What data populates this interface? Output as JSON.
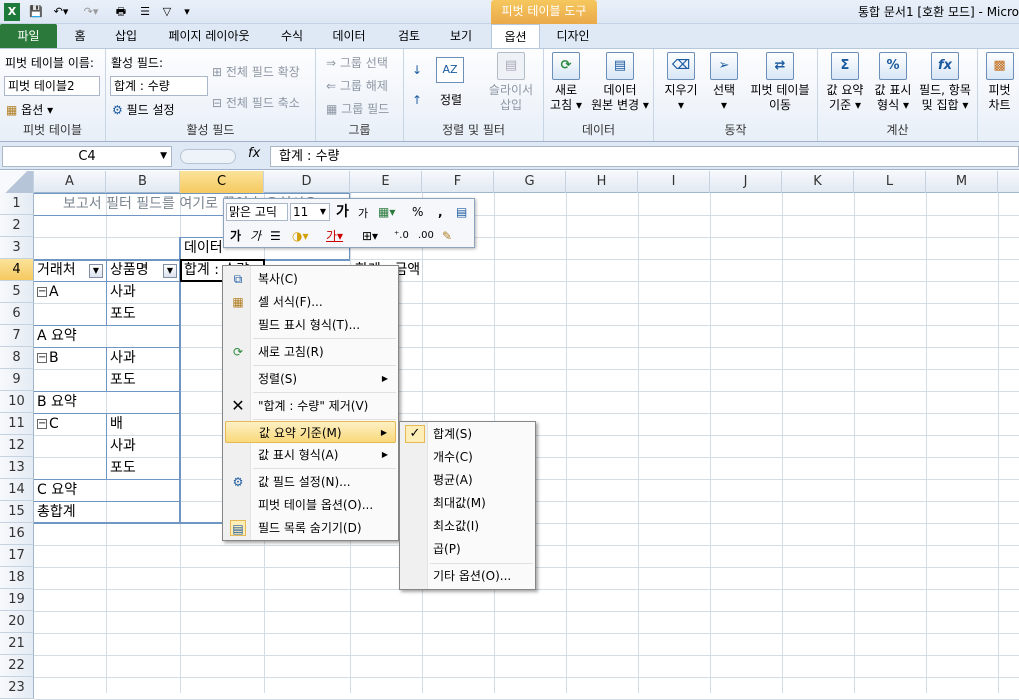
{
  "title_bar": {
    "app_icon": "excel-icon",
    "contextual_tab_group": "피벗 테이블 도구",
    "window_title": "통합 문서1 [호환 모드] - Micro"
  },
  "tabs": [
    "파일",
    "홈",
    "삽입",
    "페이지 레이아웃",
    "수식",
    "데이터",
    "검토",
    "보기",
    "옵션",
    "디자인"
  ],
  "active_tab": "옵션",
  "ribbon": {
    "pivottable": {
      "name_label": "피벗 테이블 이름:",
      "name_value": "피벗 테이블2",
      "options": "옵션",
      "label": "피벗 테이블"
    },
    "active_field": {
      "field_label": "활성 필드:",
      "field_value": "합계 : 수량",
      "field_settings": "필드 설정",
      "expand": "전체 필드 확장",
      "collapse": "전체 필드 축소",
      "label": "활성 필드"
    },
    "group": {
      "selection": "그룹 선택",
      "ungroup": "그룹 해제",
      "group_field": "그룹 필드",
      "label": "그룹"
    },
    "sort": {
      "sort": "정렬",
      "slicer_line1": "슬라이서",
      "slicer_line2": "삽입",
      "label": "정렬 및 필터"
    },
    "data": {
      "refresh_line1": "새로",
      "refresh_line2": "고침",
      "change_source_line1": "데이터",
      "change_source_line2": "원본 변경",
      "label": "데이터"
    },
    "actions": {
      "clear": "지우기",
      "select": "선택",
      "move_line1": "피벗 테이블",
      "move_line2": "이동",
      "label": "동작"
    },
    "calc": {
      "summarize_line1": "값 요약",
      "summarize_line2": "기준",
      "show_values_line1": "값 표시",
      "show_values_line2": "형식",
      "fields_items_line1": "필드, 항목",
      "fields_items_line2": "및 집합",
      "label": "계산"
    },
    "pivotchart": {
      "line1": "피벗",
      "line2": "차트"
    }
  },
  "formula_bar": {
    "name_box": "C4",
    "fx": "fx",
    "formula": "합계 : 수량"
  },
  "columns": [
    "A",
    "B",
    "C",
    "D",
    "E",
    "F",
    "G",
    "H",
    "I",
    "J",
    "K",
    "L",
    "M"
  ],
  "rows": [
    "1",
    "2",
    "3",
    "4",
    "5",
    "6",
    "7",
    "8",
    "9",
    "10",
    "11",
    "12",
    "13",
    "14",
    "15",
    "16",
    "17",
    "18",
    "19",
    "20",
    "21",
    "22",
    "23"
  ],
  "selected_cell": "C4",
  "sheet": {
    "filter_hint": "보고서 필터 필드를 여기로 끌어 놓으십시오",
    "data_header": "데이터",
    "col_a_header": "거래처",
    "col_b_header": "상품명",
    "sum_header": "합계 : 수량",
    "d4": "합계 : 금액",
    "a5": "A",
    "b5": "사과",
    "b6": "포도",
    "a7": "A 요약",
    "a8": "B",
    "b8": "사과",
    "b9": "포도",
    "a10": "B 요약",
    "a11": "C",
    "b11": "배",
    "b12": "사과",
    "b13": "포도",
    "a14": "C 요약",
    "a15": "총합계"
  },
  "mini_toolbar": {
    "font": "맑은 고딕",
    "size": "11",
    "percent": "%",
    "comma": ","
  },
  "context_menu": [
    {
      "label": "복사(C)",
      "icon": "copy-icon"
    },
    {
      "label": "셀 서식(F)...",
      "icon": "format-cells-icon"
    },
    {
      "label": "필드 표시 형식(T)...",
      "icon": ""
    },
    {
      "label": "새로 고침(R)",
      "icon": "refresh-icon"
    },
    {
      "label": "정렬(S)",
      "icon": ""
    },
    {
      "label": "\"합계 : 수량\" 제거(V)",
      "icon": "remove-icon"
    },
    {
      "label": "값 요약 기준(M)",
      "icon": ""
    },
    {
      "label": "값 표시 형식(A)",
      "icon": ""
    },
    {
      "label": "값 필드 설정(N)...",
      "icon": "field-settings-icon"
    },
    {
      "label": "피벗 테이블 옵션(O)...",
      "icon": ""
    },
    {
      "label": "필드 목록 숨기기(D)",
      "icon": "field-list-icon"
    }
  ],
  "submenu": [
    "합계(S)",
    "개수(C)",
    "평균(A)",
    "최대값(M)",
    "최소값(I)",
    "곱(P)",
    "기타 옵션(O)..."
  ],
  "submenu_checked": "합계(S)"
}
